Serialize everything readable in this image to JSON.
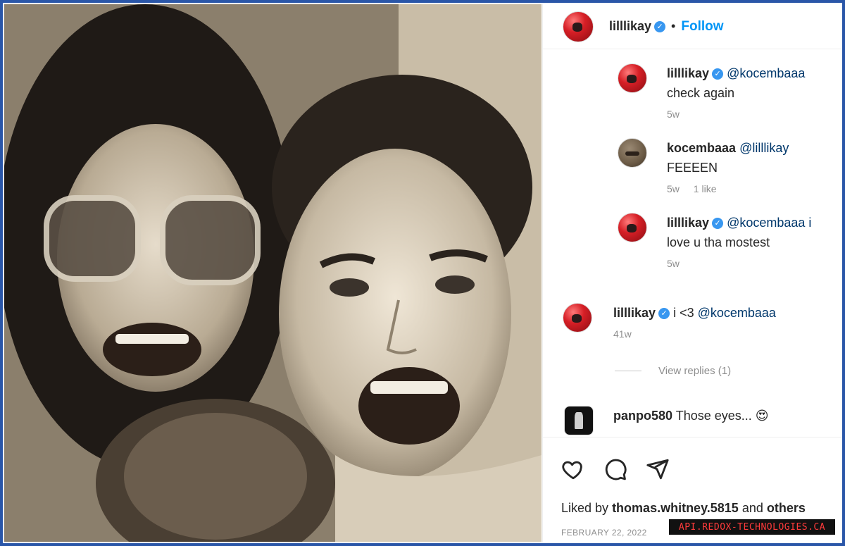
{
  "post": {
    "username": "lilllikay",
    "follow_label": "Follow",
    "separator": "•"
  },
  "comments": [
    {
      "user": "lilllikay",
      "mention": "@kocembaaa",
      "text_line1": "",
      "text": "check again",
      "time": "5w",
      "likes": ""
    },
    {
      "user": "kocembaaa",
      "mention": "@lilllikay",
      "text": "FEEEEN",
      "time": "5w",
      "likes": "1 like"
    },
    {
      "user": "lilllikay",
      "mention": "@kocembaaa i",
      "text": "love u tha mostest",
      "time": "5w",
      "likes": ""
    },
    {
      "user": "lilllikay",
      "mention": "@kocembaaa",
      "prefix": "i <3 ",
      "time": "41w"
    },
    {
      "user": "panpo580",
      "text": "Those eyes...",
      "emoji": "😍"
    }
  ],
  "view_replies": "View replies (1)",
  "footer": {
    "liked_prefix": "Liked by",
    "liked_user": "thomas.whitney.5815",
    "liked_and": "and",
    "liked_others": "others",
    "date": "FEBRUARY 22, 2022"
  },
  "watermark": "API.REDOX-TECHNOLOGIES.CA",
  "icons": [
    "heart-icon",
    "comment-icon",
    "share-icon",
    "verified-icon"
  ],
  "colors": {
    "accent": "#0095f6",
    "border": "#2a56a8",
    "verified": "#3897f0"
  }
}
